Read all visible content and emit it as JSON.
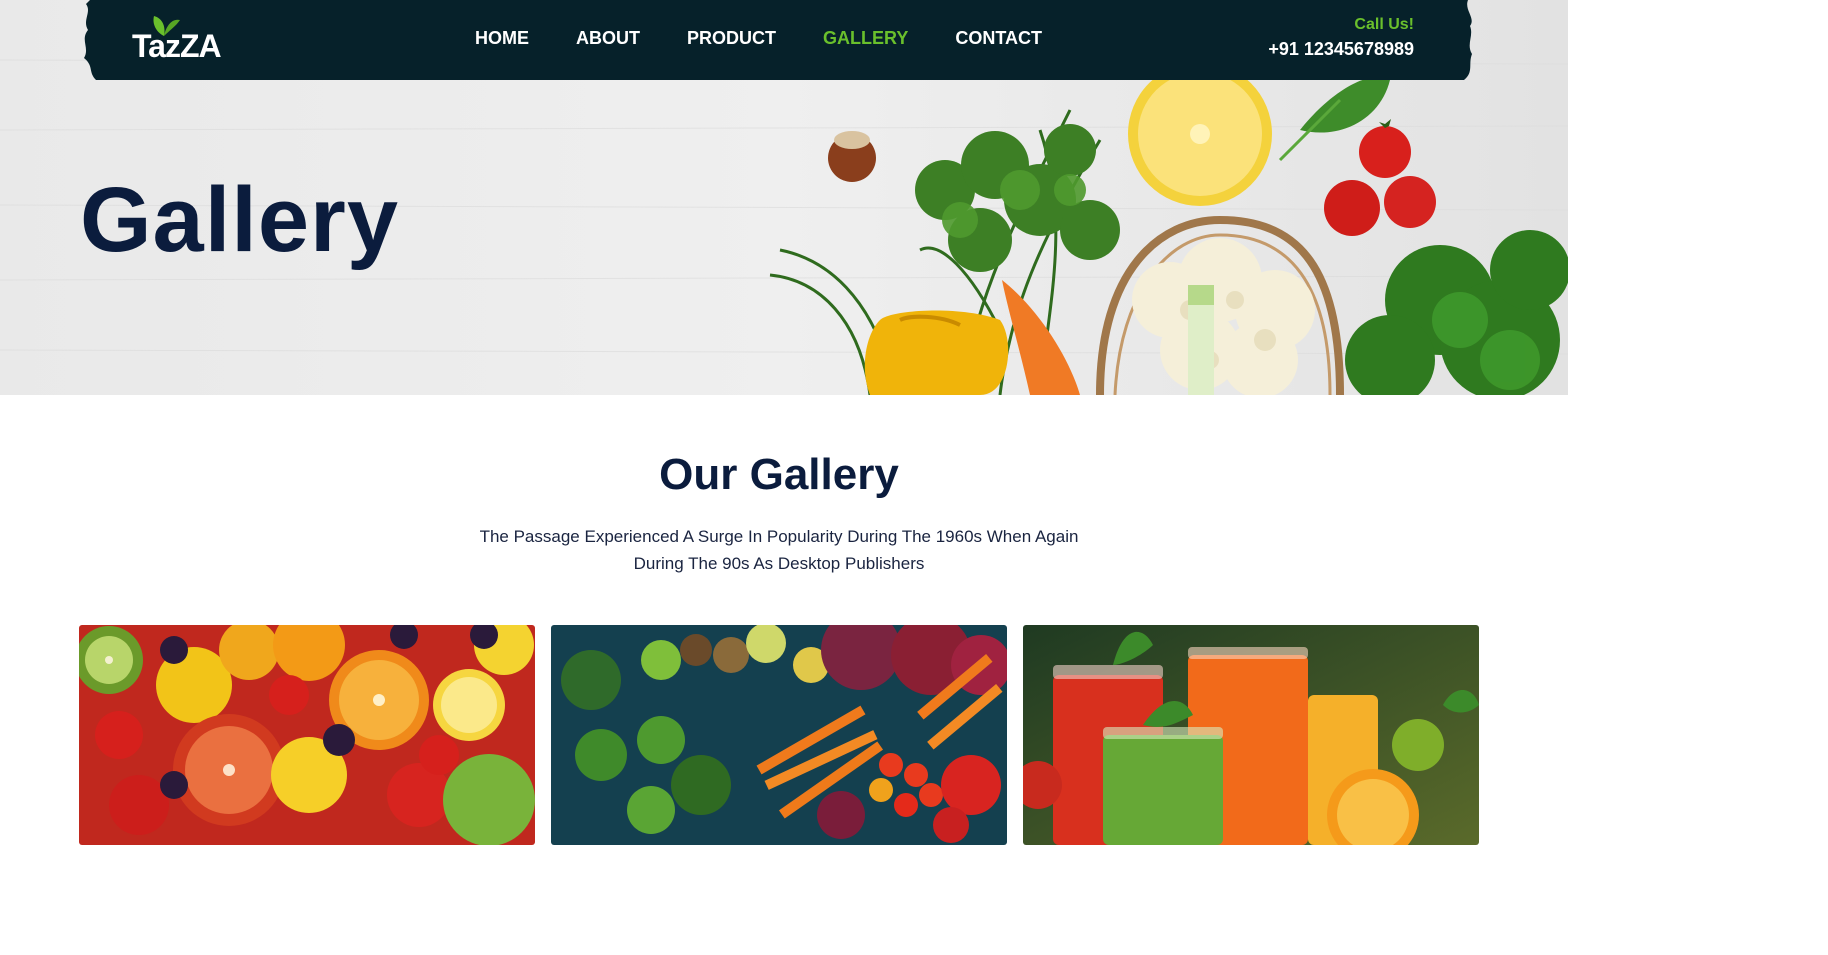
{
  "header": {
    "logo_text": "TazZA",
    "nav": [
      {
        "label": "HOME",
        "active": false
      },
      {
        "label": "ABOUT",
        "active": false
      },
      {
        "label": "PRODUCT",
        "active": false
      },
      {
        "label": "GALLERY",
        "active": true
      },
      {
        "label": "CONTACT",
        "active": false
      }
    ],
    "call_label": "Call Us!",
    "phone": "+91 12345678989"
  },
  "hero": {
    "title": "Gallery"
  },
  "gallery": {
    "title": "Our Gallery",
    "subtitle": "The Passage Experienced A Surge In Popularity During The 1960s When Again During The 90s As Desktop Publishers",
    "items": [
      {
        "name": "fruits-photo"
      },
      {
        "name": "vegetables-photo"
      },
      {
        "name": "juices-photo"
      }
    ]
  },
  "colors": {
    "header_bg": "#06212a",
    "accent_green": "#6ac02c",
    "title_navy": "#0b1c3d"
  }
}
